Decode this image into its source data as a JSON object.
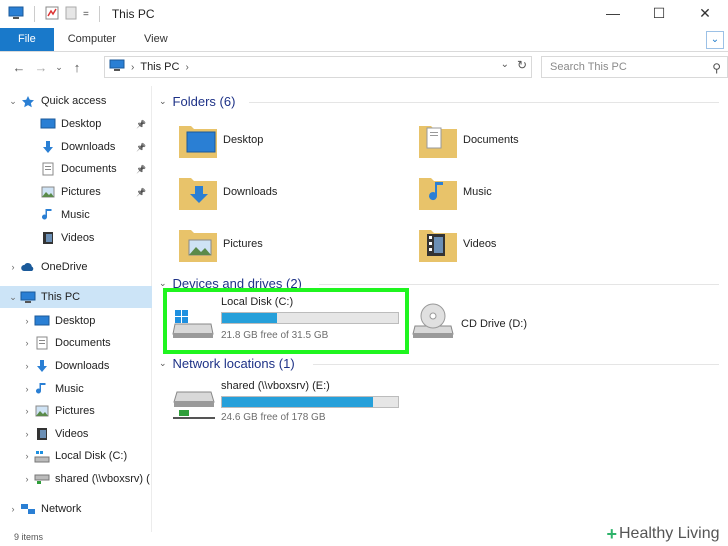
{
  "window": {
    "title": "This PC",
    "controls": [
      "—",
      "☐",
      "✕"
    ]
  },
  "ribbon": {
    "tabs": [
      "File",
      "Computer",
      "View"
    ],
    "toggle": "⌄"
  },
  "address": {
    "path": "This PC",
    "search_placeholder": "Search This PC"
  },
  "sidebar": {
    "items": [
      {
        "label": "Quick access",
        "expander": "⌄",
        "icon": "star-icon",
        "pinned": false
      },
      {
        "label": "Desktop",
        "expander": "",
        "icon": "desktop-icon",
        "pinned": true
      },
      {
        "label": "Downloads",
        "expander": "",
        "icon": "downloads-icon",
        "pinned": true
      },
      {
        "label": "Documents",
        "expander": "",
        "icon": "documents-icon",
        "pinned": true
      },
      {
        "label": "Pictures",
        "expander": "",
        "icon": "pictures-icon",
        "pinned": true
      },
      {
        "label": "Music",
        "expander": "",
        "icon": "music-icon",
        "pinned": false
      },
      {
        "label": "Videos",
        "expander": "",
        "icon": "videos-icon",
        "pinned": false
      },
      {
        "label": "OneDrive",
        "expander": "›",
        "icon": "onedrive-icon",
        "pinned": false
      },
      {
        "label": "This PC",
        "expander": "⌄",
        "icon": "this-pc-icon",
        "pinned": false,
        "selected": true
      },
      {
        "label": "Desktop",
        "expander": "›",
        "icon": "desktop-icon",
        "pinned": false
      },
      {
        "label": "Documents",
        "expander": "›",
        "icon": "documents-icon",
        "pinned": false
      },
      {
        "label": "Downloads",
        "expander": "›",
        "icon": "downloads-icon",
        "pinned": false
      },
      {
        "label": "Music",
        "expander": "›",
        "icon": "music-icon",
        "pinned": false
      },
      {
        "label": "Pictures",
        "expander": "›",
        "icon": "pictures-icon",
        "pinned": false
      },
      {
        "label": "Videos",
        "expander": "›",
        "icon": "videos-icon",
        "pinned": false
      },
      {
        "label": "Local Disk (C:)",
        "expander": "›",
        "icon": "local-disk-icon",
        "pinned": false
      },
      {
        "label": "shared (\\\\vboxsrv) (",
        "expander": "›",
        "icon": "network-drive-icon",
        "pinned": false
      },
      {
        "label": "Network",
        "expander": "›",
        "icon": "network-icon",
        "pinned": false
      }
    ]
  },
  "groups": {
    "folders": {
      "title": "Folders (6)"
    },
    "devices": {
      "title": "Devices and drives (2)"
    },
    "network": {
      "title": "Network locations (1)"
    }
  },
  "folders": [
    {
      "label": "Desktop",
      "icon": "desktop-folder-icon"
    },
    {
      "label": "Documents",
      "icon": "documents-folder-icon"
    },
    {
      "label": "Downloads",
      "icon": "downloads-folder-icon"
    },
    {
      "label": "Music",
      "icon": "music-folder-icon"
    },
    {
      "label": "Pictures",
      "icon": "pictures-folder-icon"
    },
    {
      "label": "Videos",
      "icon": "videos-folder-icon"
    }
  ],
  "drives": {
    "local": {
      "name": "Local Disk (C:)",
      "free": "21.8 GB free of 31.5 GB",
      "used_fraction": 0.31
    },
    "cd": {
      "name": "CD Drive (D:)"
    },
    "shared": {
      "name": "shared (\\\\vboxsrv) (E:)",
      "free": "24.6 GB free of 178 GB",
      "used_fraction": 0.86
    }
  },
  "status": {
    "text": "9 items"
  },
  "watermark": {
    "text": "Healthy Living"
  },
  "colors": {
    "accent": "#1979ca",
    "highlight": "#1ff51f",
    "bar_fill": "#26a0da",
    "group_header": "#1e3287"
  }
}
